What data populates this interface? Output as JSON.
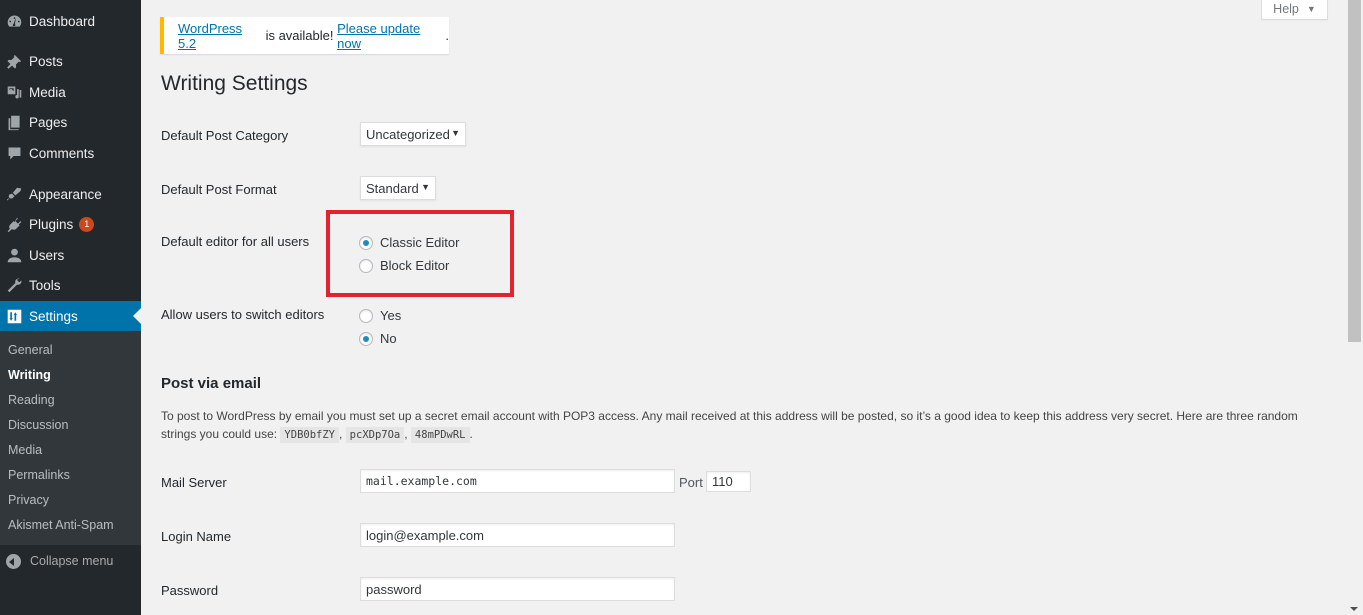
{
  "sidebar": {
    "items": [
      {
        "label": "Dashboard",
        "icon": "dashboard-icon"
      },
      {
        "label": "Posts",
        "icon": "pin-icon"
      },
      {
        "label": "Media",
        "icon": "media-icon"
      },
      {
        "label": "Pages",
        "icon": "pages-icon"
      },
      {
        "label": "Comments",
        "icon": "comment-icon"
      },
      {
        "label": "Appearance",
        "icon": "paintbrush-icon"
      },
      {
        "label": "Plugins",
        "icon": "plugin-icon",
        "badge": "1"
      },
      {
        "label": "Users",
        "icon": "user-icon"
      },
      {
        "label": "Tools",
        "icon": "wrench-icon"
      },
      {
        "label": "Settings",
        "icon": "settings-icon",
        "current": true
      }
    ],
    "submenu": [
      "General",
      "Writing",
      "Reading",
      "Discussion",
      "Media",
      "Permalinks",
      "Privacy",
      "Akismet Anti-Spam"
    ],
    "submenu_current": "Writing",
    "collapse_label": "Collapse menu"
  },
  "help": {
    "label": "Help",
    "arrow": "▼"
  },
  "notice": {
    "link1": "WordPress 5.2",
    "middle": " is available! ",
    "link2": "Please update now",
    "end": "."
  },
  "page": {
    "title": "Writing Settings"
  },
  "settings": {
    "default_category": {
      "label": "Default Post Category",
      "value": "Uncategorized"
    },
    "default_format": {
      "label": "Default Post Format",
      "value": "Standard"
    },
    "default_editor": {
      "label": "Default editor for all users",
      "options": [
        "Classic Editor",
        "Block Editor"
      ],
      "selected": "Classic Editor"
    },
    "allow_switch": {
      "label": "Allow users to switch editors",
      "options": [
        "Yes",
        "No"
      ],
      "selected": "No"
    }
  },
  "post_via_email": {
    "title": "Post via email",
    "description_line1": "To post to WordPress by email you must set up a secret email account with POP3 access. Any mail received at this address will be posted, so it’s a good idea to keep this address very secret. Here are three random strings you",
    "description_prefix": "could use: ",
    "random_strings": [
      "YDB0bfZY",
      "pcXDp7Oa",
      "48mPDwRL"
    ],
    "mail_server": {
      "label": "Mail Server",
      "value": "mail.example.com"
    },
    "port": {
      "label": "Port",
      "value": "110"
    },
    "login_name": {
      "label": "Login Name",
      "value": "login@example.com"
    },
    "password": {
      "label": "Password",
      "value": "password"
    }
  },
  "colors": {
    "accent": "#0073aa",
    "sidebar_bg": "#23282d",
    "submenu_bg": "#32373c",
    "notice_border": "#ffb900",
    "highlight_box": "#e3222b",
    "badge": "#ca4a1f"
  }
}
